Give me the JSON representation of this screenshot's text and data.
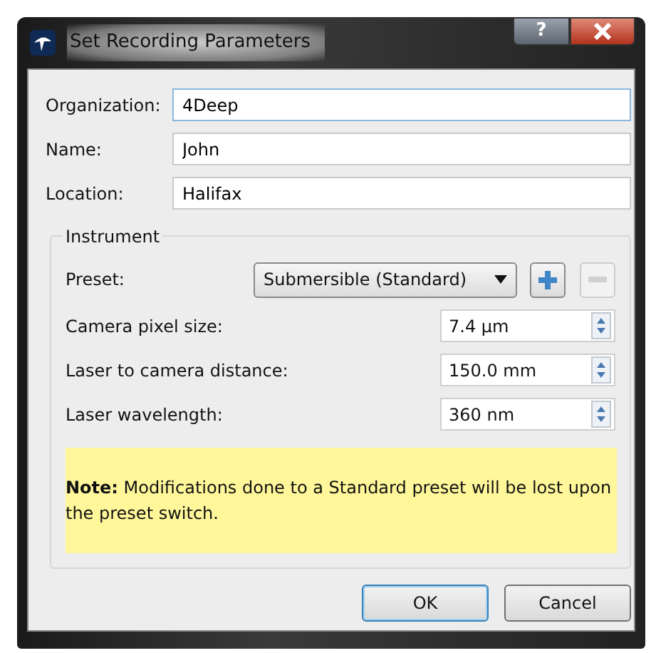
{
  "window": {
    "title": "Set Recording Parameters",
    "help_button": "?"
  },
  "fields": [
    {
      "label": "Organization:",
      "value": "4Deep",
      "focused": true
    },
    {
      "label": "Name:",
      "value": "John",
      "focused": false
    },
    {
      "label": "Location:",
      "value": "Halifax",
      "focused": false
    }
  ],
  "instrument": {
    "title": "Instrument",
    "preset": {
      "label": "Preset:",
      "value": "Submersible (Standard)"
    },
    "add_button": {
      "disabled": false
    },
    "remove_button": {
      "disabled": true
    },
    "spinboxes": [
      {
        "label": "Camera pixel size:",
        "value": "7.4 µm"
      },
      {
        "label": "Laser to camera distance:",
        "value": "150.0 mm"
      },
      {
        "label": "Laser wavelength:",
        "value": "360 nm"
      }
    ],
    "note": "**Note:** Modifications done to a Standard preset will be lost upon the preset switch."
  },
  "buttons": [
    {
      "label": "OK",
      "default": true
    },
    {
      "label": "Cancel",
      "default": false
    }
  ]
}
